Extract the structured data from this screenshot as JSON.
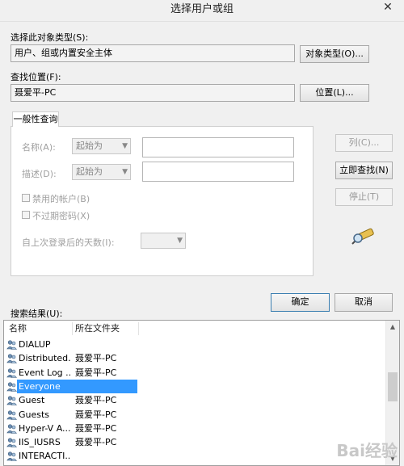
{
  "window": {
    "title": "选择用户或组",
    "close_glyph": "✕"
  },
  "object_type": {
    "label": "选择此对象类型(S):",
    "value": "用户、组或内置安全主体",
    "button": "对象类型(O)..."
  },
  "location": {
    "label": "查找位置(F):",
    "value": "聂爱平-PC",
    "button": "位置(L)..."
  },
  "query": {
    "tab": "一般性查询",
    "name_label": "名称(A):",
    "name_mode": "起始为",
    "name_value": "",
    "desc_label": "描述(D):",
    "desc_mode": "起始为",
    "desc_value": "",
    "disabled_accounts": "禁用的帐户(B)",
    "non_expiring": "不过期密码(X)",
    "days_label": "自上次登录后的天数(I):",
    "days_value": ""
  },
  "side_buttons": {
    "columns": "列(C)...",
    "find_now": "立即查找(N)",
    "stop": "停止(T)"
  },
  "footer": {
    "ok": "确定",
    "cancel": "取消"
  },
  "results": {
    "label": "搜索结果(U):",
    "columns": [
      "名称",
      "所在文件夹"
    ],
    "rows": [
      {
        "name": "DIALUP",
        "folder": ""
      },
      {
        "name": "Distributed...",
        "folder": "聂爱平-PC"
      },
      {
        "name": "Event Log ...",
        "folder": "聂爱平-PC"
      },
      {
        "name": "Everyone",
        "folder": "",
        "selected": true
      },
      {
        "name": "Guest",
        "folder": "聂爱平-PC"
      },
      {
        "name": "Guests",
        "folder": "聂爱平-PC"
      },
      {
        "name": "Hyper-V A...",
        "folder": "聂爱平-PC"
      },
      {
        "name": "IIS_IUSRS",
        "folder": "聂爱平-PC"
      },
      {
        "name": "INTERACTI...",
        "folder": ""
      }
    ]
  },
  "watermark": "Bai经验",
  "colors": {
    "selection": "#3399ff",
    "window_bg": "#f0f0f0"
  }
}
